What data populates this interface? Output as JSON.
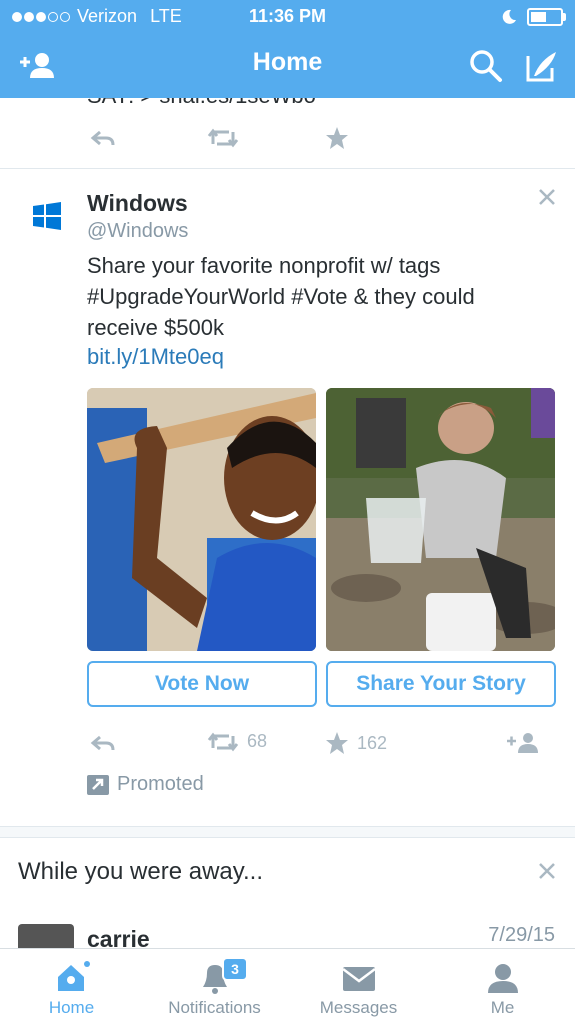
{
  "status_bar": {
    "carrier": "Verizon",
    "network": "LTE",
    "time": "11:36 PM",
    "battery_level": 0.55
  },
  "nav": {
    "title": "Home",
    "icons": [
      "add-user-icon",
      "search-icon",
      "compose-icon"
    ]
  },
  "prev_tweet": {
    "partial_text": "SAY: > snai.es/1seWbo"
  },
  "tweet": {
    "name": "Windows",
    "handle": "@Windows",
    "text": "Share your favorite nonprofit w/ tags #UpgradeYourWorld #Vote & they could receive $500k",
    "link": "bit.ly/1Mte0eq",
    "buttons": {
      "vote": "Vote Now",
      "share": "Share Your Story"
    },
    "retweets": "68",
    "favorites": "162",
    "promoted": "Promoted"
  },
  "away": {
    "title": "While you were away...",
    "user": "carrie",
    "date": "7/29/15"
  },
  "tabs": [
    {
      "label": "Home",
      "active": true
    },
    {
      "label": "Notifications",
      "badge": "3"
    },
    {
      "label": "Messages"
    },
    {
      "label": "Me"
    }
  ],
  "colors": {
    "brand": "#55acee",
    "link": "#2b7bb9",
    "muted": "#8899a6",
    "action": "#aab8c2",
    "windows": "#0078d7"
  }
}
